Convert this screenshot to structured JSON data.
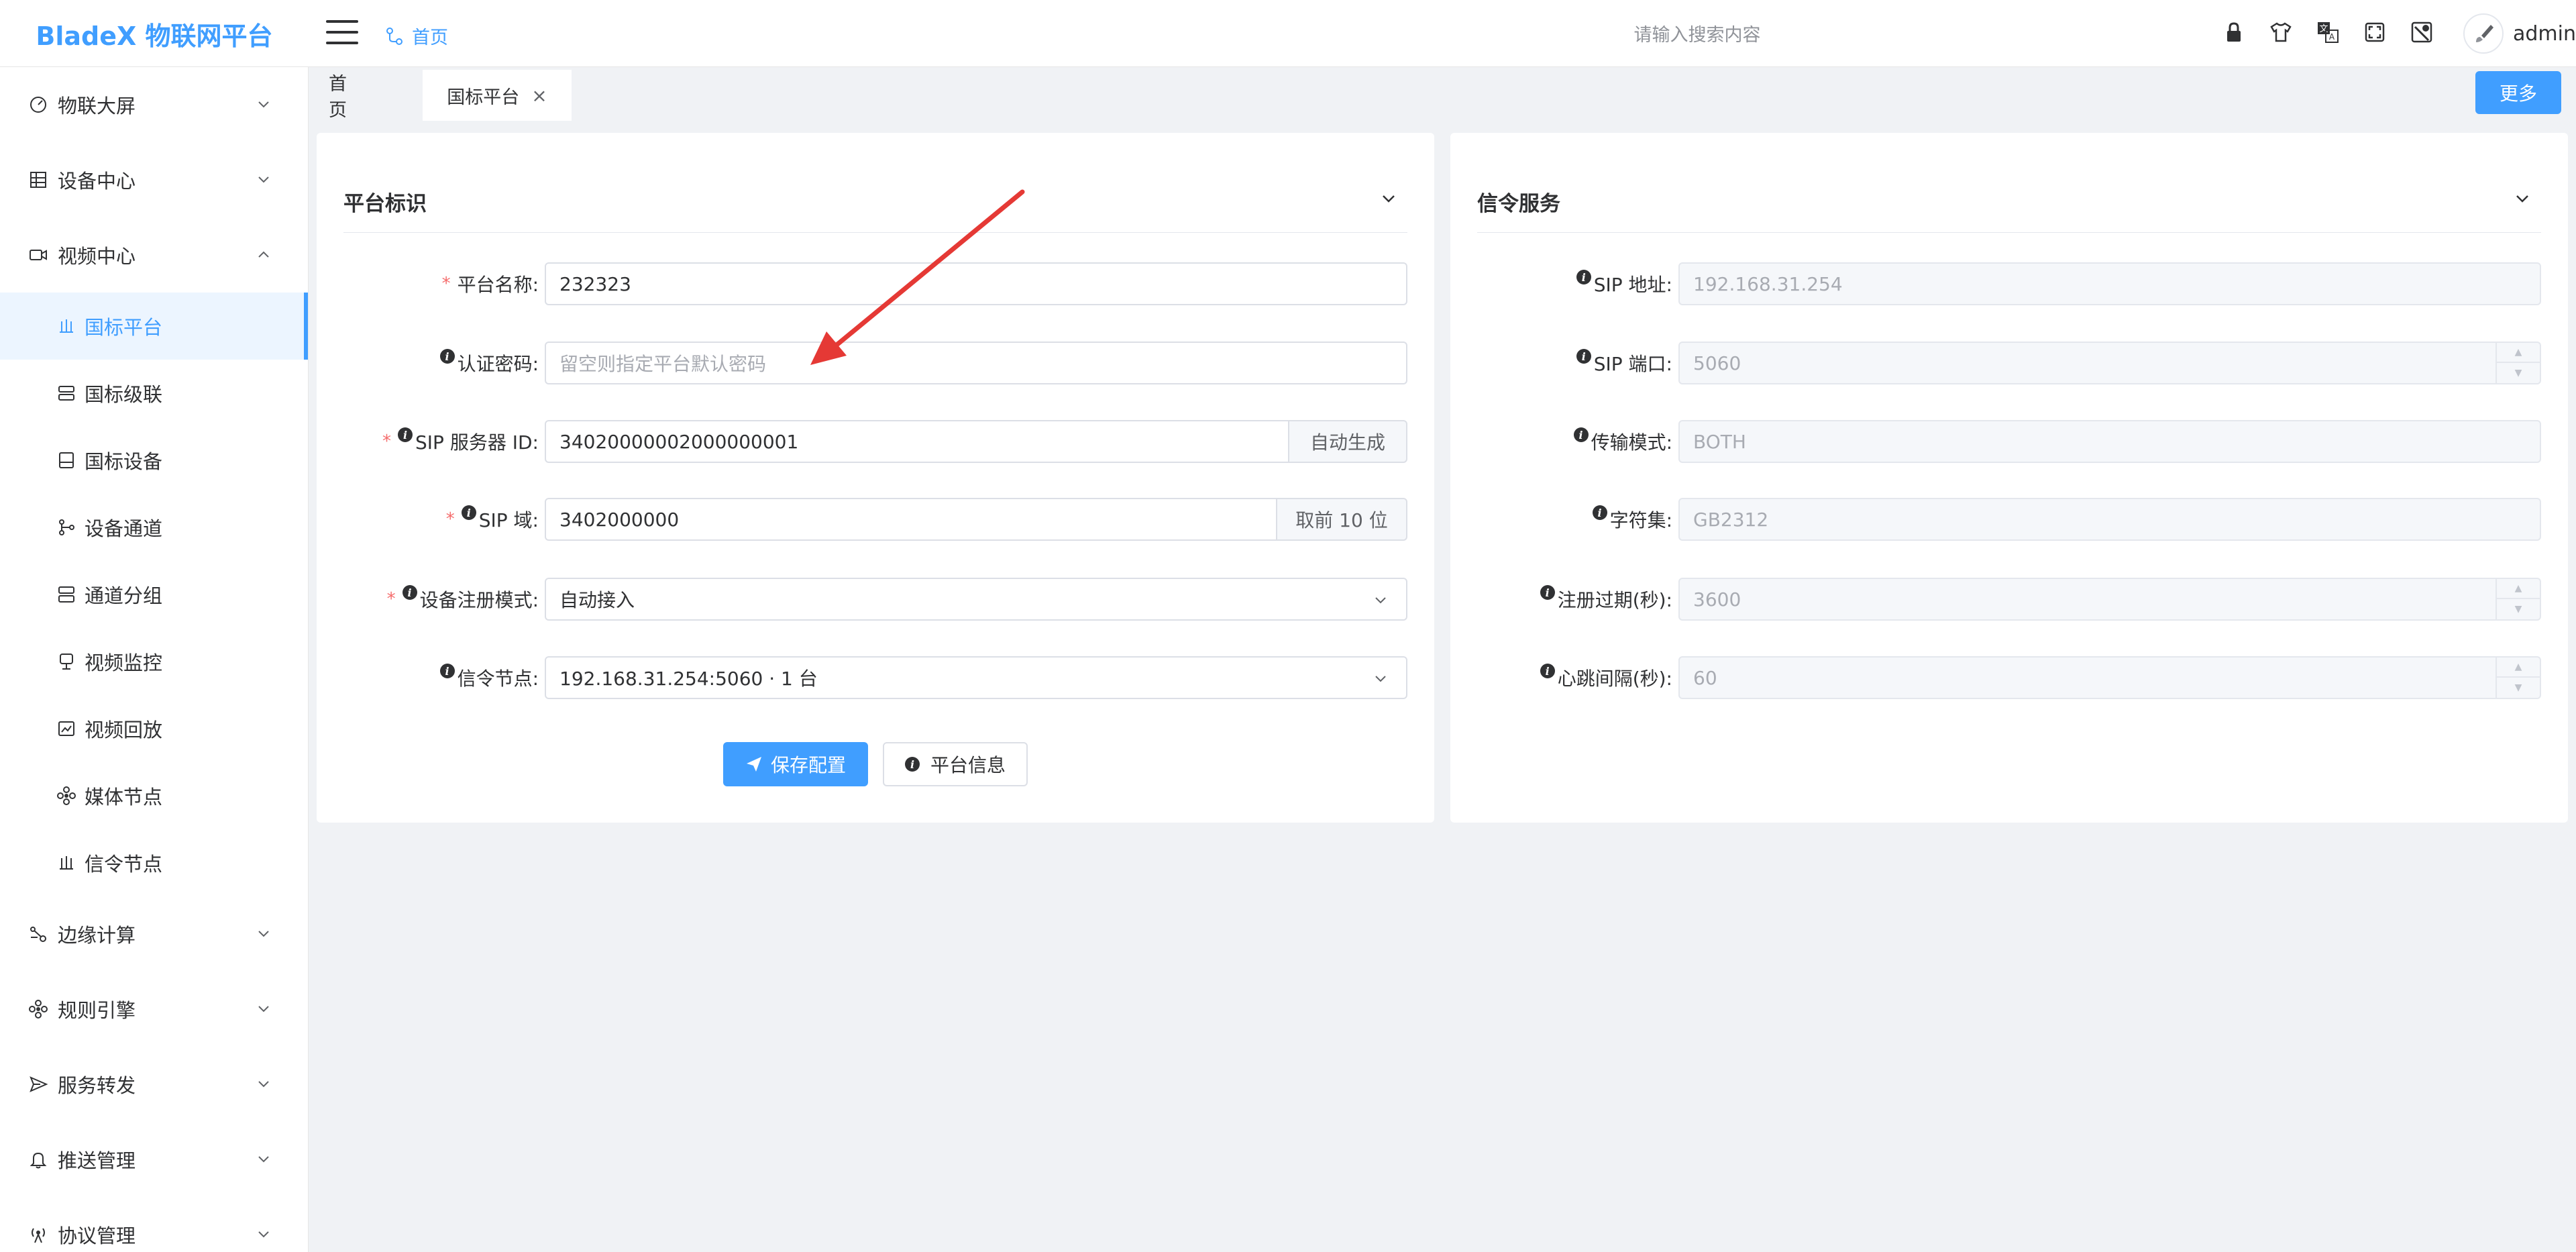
{
  "app": {
    "logo": "BladeX 物联网平台",
    "username": "admin",
    "search_placeholder": "请输入搜索内容"
  },
  "breadcrumb": {
    "home": "首页"
  },
  "top_icons": [
    "lock-icon",
    "shirt-icon",
    "translate-icon",
    "fullscreen-icon",
    "theme-icon"
  ],
  "sidebar": {
    "groups_top": [
      {
        "label": "物联大屏",
        "icon": "dashboard-icon",
        "expanded": false
      },
      {
        "label": "设备中心",
        "icon": "device-icon",
        "expanded": false
      },
      {
        "label": "视频中心",
        "icon": "video-icon",
        "expanded": true
      }
    ],
    "video_items": [
      {
        "label": "国标平台",
        "icon": "platform-icon",
        "active": true
      },
      {
        "label": "国标级联",
        "icon": "cascade-icon"
      },
      {
        "label": "国标设备",
        "icon": "gb-device-icon"
      },
      {
        "label": "设备通道",
        "icon": "channel-icon"
      },
      {
        "label": "通道分组",
        "icon": "group-icon"
      },
      {
        "label": "视频监控",
        "icon": "monitor-icon"
      },
      {
        "label": "视频回放",
        "icon": "playback-icon"
      },
      {
        "label": "媒体节点",
        "icon": "media-node-icon"
      },
      {
        "label": "信令节点",
        "icon": "signal-node-icon"
      }
    ],
    "groups_bottom": [
      {
        "label": "边缘计算",
        "icon": "edge-icon"
      },
      {
        "label": "规则引擎",
        "icon": "rule-icon"
      },
      {
        "label": "服务转发",
        "icon": "forward-icon"
      },
      {
        "label": "推送管理",
        "icon": "bell-icon"
      },
      {
        "label": "协议管理",
        "icon": "protocol-icon"
      }
    ]
  },
  "tabs": [
    {
      "label": "首页"
    },
    {
      "label": "国标平台",
      "active": true,
      "close": "×"
    }
  ],
  "more_button": "更多",
  "left_card": {
    "title": "平台标识",
    "fields": {
      "platform_name": {
        "label": "平台名称:",
        "value": "232323",
        "required": true
      },
      "auth_password": {
        "label": "认证密码:",
        "placeholder": "留空则指定平台默认密码"
      },
      "sip_server_id": {
        "label": "SIP 服务器 ID:",
        "value": "34020000002000000001",
        "append": "自动生成",
        "required": true
      },
      "sip_domain": {
        "label": "SIP 域:",
        "value": "3402000000",
        "append": "取前 10 位",
        "required": true
      },
      "register_mode": {
        "label": "设备注册模式:",
        "value": "自动接入",
        "required": true
      },
      "signal_node": {
        "label": "信令节点:",
        "value": "192.168.31.254:5060 · 1 台"
      }
    },
    "save_button": "保存配置",
    "info_button": "平台信息"
  },
  "right_card": {
    "title": "信令服务",
    "fields": {
      "sip_address": {
        "label": "SIP 地址:",
        "value": "192.168.31.254"
      },
      "sip_port": {
        "label": "SIP 端口:",
        "value": "5060"
      },
      "transport": {
        "label": "传输模式:",
        "value": "BOTH"
      },
      "charset": {
        "label": "字符集:",
        "value": "GB2312"
      },
      "register_expire": {
        "label": "注册过期(秒):",
        "value": "3600"
      },
      "heartbeat": {
        "label": "心跳间隔(秒):",
        "value": "60"
      }
    }
  },
  "colors": {
    "primary": "#409eff",
    "danger": "#f56c6c",
    "annotation_arrow": "#e53935"
  }
}
